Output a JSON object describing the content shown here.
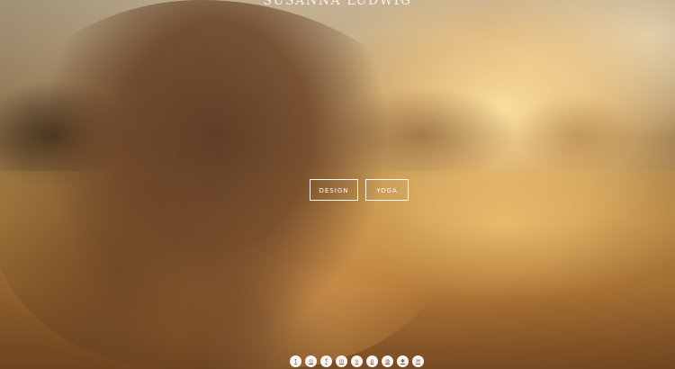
{
  "site": {
    "title": "SUSANNA LUDWIG"
  },
  "nav": {
    "items": [
      {
        "label": "DESIGN"
      },
      {
        "label": "YOGA"
      }
    ]
  },
  "social": {
    "icons": [
      {
        "name": "twitter-icon",
        "glyph": "t"
      },
      {
        "name": "instagram-icon",
        "glyph": "◎"
      },
      {
        "name": "facebook-icon",
        "glyph": "f"
      },
      {
        "name": "linkedin-icon",
        "glyph": "in"
      },
      {
        "name": "vimeo-icon",
        "glyph": "v"
      },
      {
        "name": "pinterest-icon",
        "glyph": "p"
      },
      {
        "name": "dribbble-icon",
        "glyph": "◍"
      },
      {
        "name": "flickr-icon",
        "glyph": "✱"
      },
      {
        "name": "email-icon",
        "glyph": "✉"
      }
    ]
  },
  "colors": {
    "text": "#ffffff",
    "icon_fg": "#8a5a34"
  }
}
